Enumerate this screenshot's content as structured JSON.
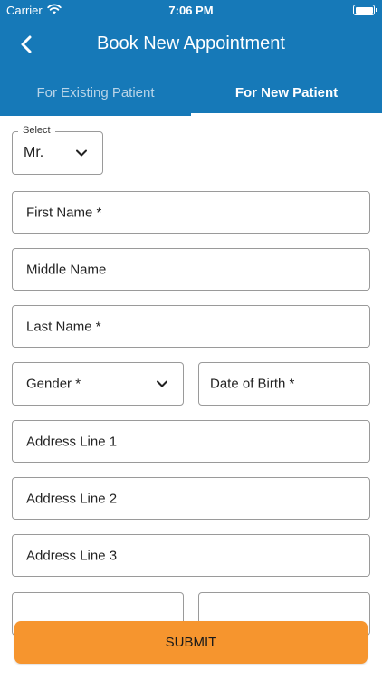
{
  "status_bar": {
    "carrier": "Carrier",
    "time": "7:06 PM"
  },
  "nav": {
    "title": "Book New Appointment",
    "back_icon": "chevron-left-icon"
  },
  "tabs": [
    {
      "label": "For Existing Patient",
      "selected": false
    },
    {
      "label": "For New Patient",
      "selected": true
    }
  ],
  "form": {
    "salutation": {
      "legend": "Select",
      "value": "Mr."
    },
    "first_name": "First Name *",
    "middle_name": "Middle Name",
    "last_name": "Last Name *",
    "gender": "Gender *",
    "dob": "Date of Birth *",
    "address1": "Address Line 1",
    "address2": "Address Line 2",
    "address3": "Address Line 3"
  },
  "submit_label": "SUBMIT",
  "colors": {
    "header": "#1679b8",
    "submit": "#f6952e",
    "border": "#9a9a9a"
  }
}
